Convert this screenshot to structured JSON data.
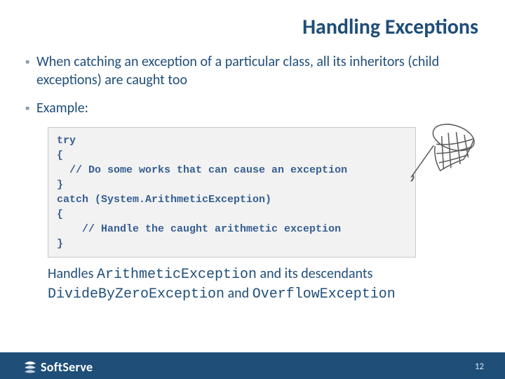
{
  "title": "Handling Exceptions",
  "bullets": {
    "b1": "When catching an exception of a particular class, all its inheritors (child exceptions) are caught too",
    "b2": "Example:"
  },
  "code": "try\n{\n  // Do some works that can cause an exception\n}\ncatch (System.ArithmeticException)\n{\n    // Handle the caught arithmetic exception\n}",
  "tail": {
    "t1": "Handles ",
    "t2": "ArithmeticException",
    "t3": " and its descendants ",
    "t4": "DivideByZeroException",
    "t5": " and ",
    "t6": "OverflowException"
  },
  "logo": {
    "name": "SoftServe"
  },
  "page": "12"
}
